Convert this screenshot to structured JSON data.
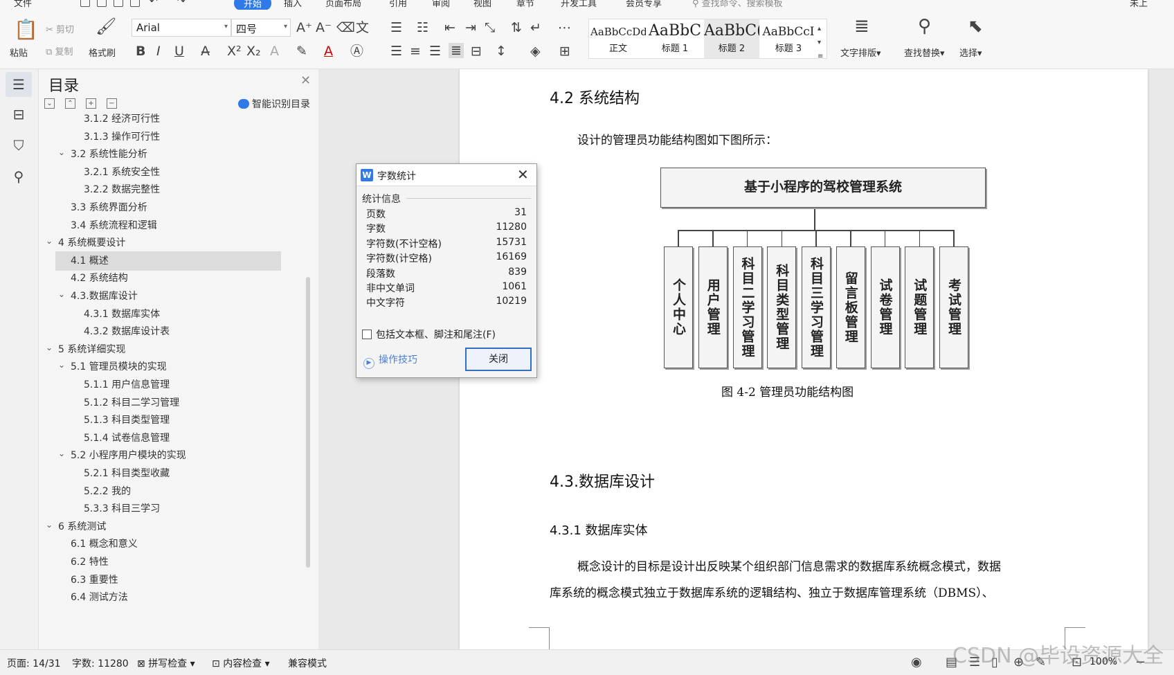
{
  "ribbon": {
    "tabs": [
      "文件",
      "开始",
      "插入",
      "页面布局",
      "引用",
      "审阅",
      "视图",
      "章节",
      "开发工具",
      "会员专享"
    ],
    "active_tab": "开始",
    "search_placeholder": "查找命令、搜索模板",
    "account": "未上",
    "clipboard": {
      "paste": "粘贴",
      "cut": "剪切",
      "copy": "复制",
      "format_painter": "格式刷"
    },
    "font_name": "Arial",
    "font_size": "四号",
    "styles": [
      {
        "sample": "AaBbCcDd",
        "name": "正文"
      },
      {
        "sample": "AaBbC",
        "name": "标题 1"
      },
      {
        "sample": "AaBbC(",
        "name": "标题 2"
      },
      {
        "sample": "AaBbCcI",
        "name": "标题 3"
      }
    ],
    "text_layout": "文字排版",
    "find_replace": "查找替换",
    "select": "选择"
  },
  "toc": {
    "title": "目录",
    "smart": "智能识别目录",
    "items": [
      {
        "label": "3.1.2 经济可行性",
        "level": 3,
        "expanded": null,
        "selected": false
      },
      {
        "label": "3.1.3 操作可行性",
        "level": 3,
        "expanded": null,
        "selected": false
      },
      {
        "label": "3.2 系统性能分析",
        "level": 2,
        "expanded": true,
        "selected": false
      },
      {
        "label": "3.2.1  系统安全性",
        "level": 3,
        "expanded": null,
        "selected": false
      },
      {
        "label": "3.2.2  数据完整性",
        "level": 3,
        "expanded": null,
        "selected": false
      },
      {
        "label": "3.3 系统界面分析",
        "level": 2,
        "expanded": null,
        "selected": false
      },
      {
        "label": "3.4 系统流程和逻辑",
        "level": 2,
        "expanded": null,
        "selected": false
      },
      {
        "label": "4 系统概要设计",
        "level": 1,
        "expanded": true,
        "selected": false
      },
      {
        "label": "4.1 概述",
        "level": 2,
        "expanded": null,
        "selected": true
      },
      {
        "label": "4.2 系统结构",
        "level": 2,
        "expanded": null,
        "selected": false
      },
      {
        "label": "4.3.数据库设计",
        "level": 2,
        "expanded": true,
        "selected": false
      },
      {
        "label": "4.3.1 数据库实体",
        "level": 3,
        "expanded": null,
        "selected": false
      },
      {
        "label": "4.3.2 数据库设计表",
        "level": 3,
        "expanded": null,
        "selected": false
      },
      {
        "label": "5 系统详细实现",
        "level": 1,
        "expanded": true,
        "selected": false
      },
      {
        "label": "5.1  管理员模块的实现",
        "level": 2,
        "expanded": true,
        "selected": false
      },
      {
        "label": "5.1.1  用户信息管理",
        "level": 3,
        "expanded": null,
        "selected": false
      },
      {
        "label": "5.1.2  科目二学习管理",
        "level": 3,
        "expanded": null,
        "selected": false
      },
      {
        "label": "5.1.3  科目类型管理",
        "level": 3,
        "expanded": null,
        "selected": false
      },
      {
        "label": "5.1.4  试卷信息管理",
        "level": 3,
        "expanded": null,
        "selected": false
      },
      {
        "label": "5.2  小程序用户模块的实现",
        "level": 2,
        "expanded": true,
        "selected": false
      },
      {
        "label": "5.2.1  科目类型收藏",
        "level": 3,
        "expanded": null,
        "selected": false
      },
      {
        "label": "5.2.2  我的",
        "level": 3,
        "expanded": null,
        "selected": false
      },
      {
        "label": "5.3.3  科目三学习",
        "level": 3,
        "expanded": null,
        "selected": false
      },
      {
        "label": "6 系统测试",
        "level": 1,
        "expanded": true,
        "selected": false
      },
      {
        "label": "6.1 概念和意义",
        "level": 2,
        "expanded": null,
        "selected": false
      },
      {
        "label": "6.2 特性",
        "level": 2,
        "expanded": null,
        "selected": false
      },
      {
        "label": "6.3 重要性",
        "level": 2,
        "expanded": null,
        "selected": false
      },
      {
        "label": "6.4 测试方法",
        "level": 2,
        "expanded": null,
        "selected": false
      }
    ]
  },
  "document": {
    "heading_42": "4.2 系统结构",
    "intro": "设计的管理员功能结构图如下图所示：",
    "diagram_root": "基于小程序的驾校管理系统",
    "diagram_children": [
      "个人中心",
      "用户管理",
      "科目二学习管理",
      "科目类型管理",
      "科目三学习管理",
      "留言板管理",
      "试卷管理",
      "试题管理",
      "考试管理"
    ],
    "caption": "图 4-2 管理员功能结构图",
    "heading_43": "4.3.数据库设计",
    "heading_431": "4.3.1 数据库实体",
    "para_line1": "概念设计的目标是设计出反映某个组织部门信息需求的数据库系统概念模式，数据",
    "para_line2": "库系统的概念模式独立于数据库系统的逻辑结构、独立于数据库管理系统（DBMS）、"
  },
  "dialog": {
    "title": "字数统计",
    "section": "统计信息",
    "stats": [
      {
        "label": "页数",
        "value": "31"
      },
      {
        "label": "字数",
        "value": "11280"
      },
      {
        "label": "字符数(不计空格)",
        "value": "15731"
      },
      {
        "label": "字符数(计空格)",
        "value": "16169"
      },
      {
        "label": "段落数",
        "value": "839"
      },
      {
        "label": "非中文单词",
        "value": "1061"
      },
      {
        "label": "中文字符",
        "value": "10219"
      }
    ],
    "checkbox_label": "包括文本框、脚注和尾注(F)",
    "checkbox_checked": false,
    "tips": "操作技巧",
    "close": "关闭"
  },
  "status": {
    "page": "页面: 14/31",
    "words": "字数: 11280",
    "spell": "拼写检查",
    "content_check": "内容检查",
    "compat": "兼容模式",
    "zoom": "100%"
  },
  "watermark": "CSDN @毕设资源大全",
  "colors": {
    "accent": "#2f79e8",
    "selection": "#dcdcdc",
    "dialog_button_border": "#2f6fc9",
    "link": "#4a7fd6"
  }
}
